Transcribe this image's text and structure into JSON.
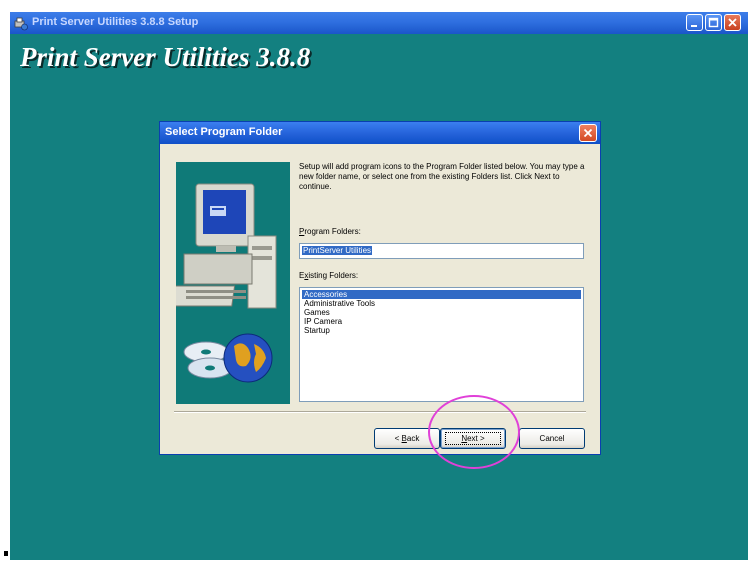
{
  "outer_window": {
    "title": "Print Server Utilities 3.8.8 Setup",
    "banner": "Print Server Utilities 3.8.8",
    "background_color": "#138080"
  },
  "dialog": {
    "title": "Select Program Folder",
    "description": "Setup will add program icons to the Program Folder listed below. You may type a new folder name, or select one from the existing Folders list. Click Next to continue.",
    "program_folders_label_accel": "P",
    "program_folders_label_rest": "rogram Folders:",
    "program_folder_value": "PrintServer Utilities",
    "existing_folders_label_pre": "E",
    "existing_folders_label_accel": "x",
    "existing_folders_label_rest": "isting Folders:",
    "existing_folders": [
      "Accessories",
      "Administrative Tools",
      "Games",
      "IP Camera",
      "Startup"
    ],
    "selected_folder_index": 0,
    "buttons": {
      "back_pre": "< ",
      "back_accel": "B",
      "back_rest": "ack",
      "next_accel": "N",
      "next_rest": "ext >",
      "cancel": "Cancel"
    }
  },
  "icons": {
    "outer_app": "setup-app-icon",
    "side_art": "computer-with-cds-and-globe"
  },
  "colors": {
    "titlebar": "#2664db",
    "selection": "#316ac5",
    "highlight_circle": "#e040d8"
  }
}
